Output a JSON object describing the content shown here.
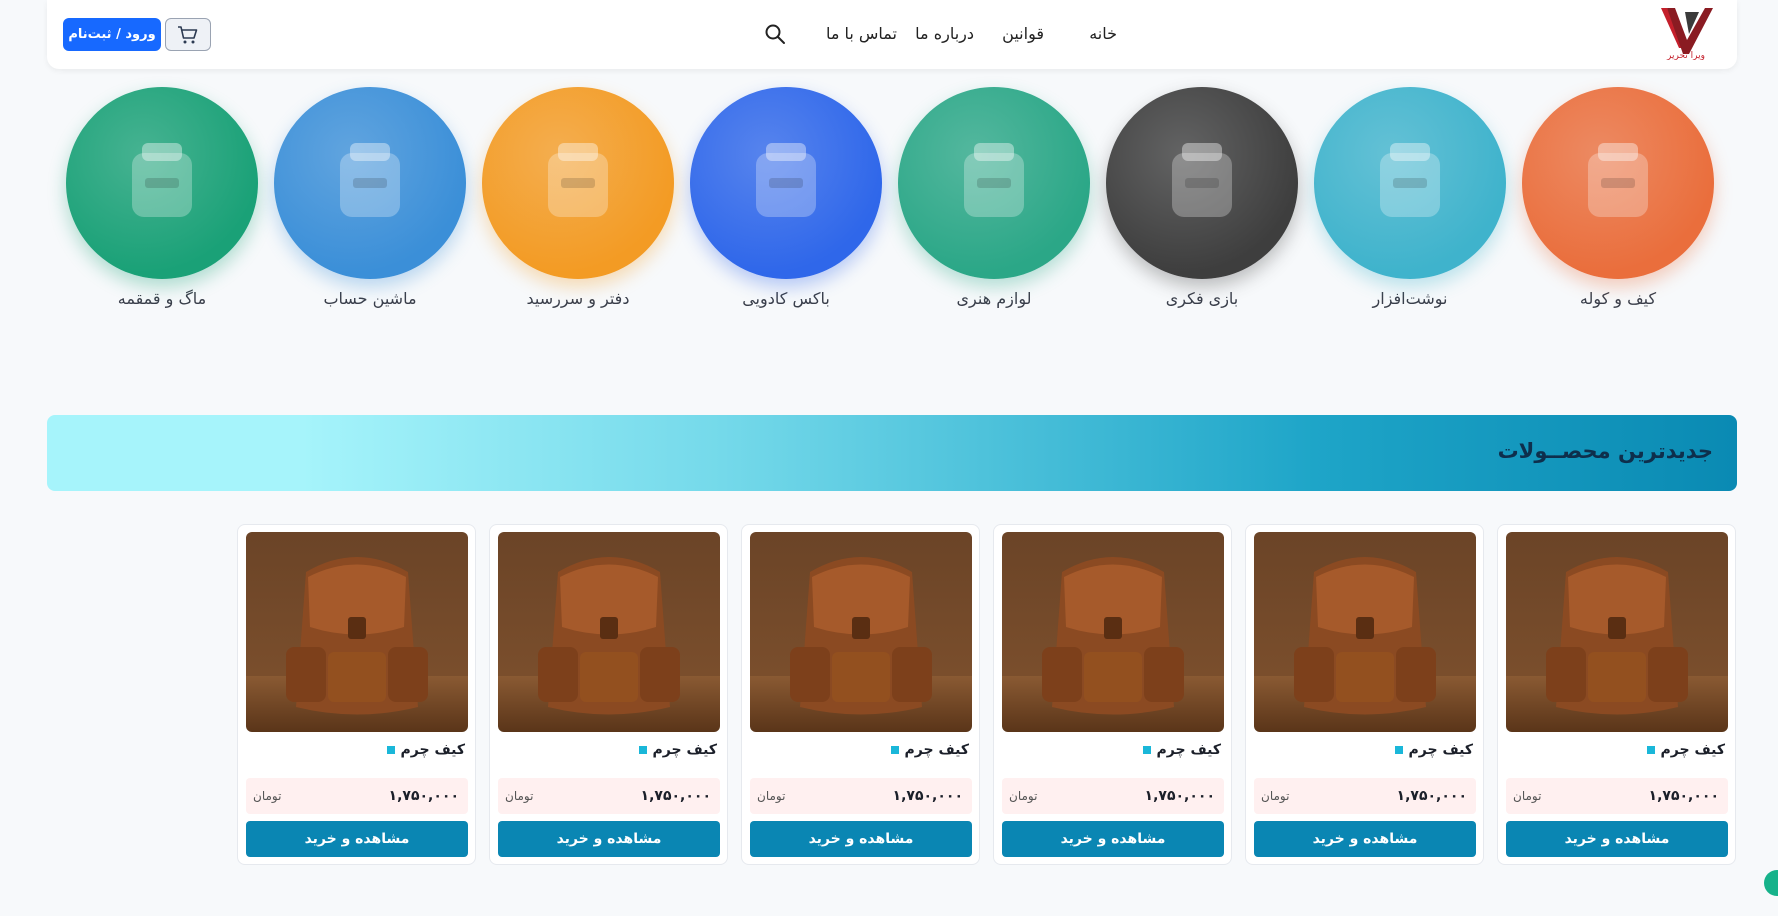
{
  "header": {
    "logo_text": "ویرا تحریر",
    "nav": {
      "home": "خانه",
      "rules": "قوانین",
      "about": "درباره ما",
      "contact": "تماس با ما"
    },
    "login_label": "ورود / ثبت‌نام",
    "icons": [
      "search-icon",
      "cart-icon"
    ]
  },
  "categories": [
    {
      "label": "کیف و کوله",
      "color": "#ea6e3c"
    },
    {
      "label": "نوشت‌افزار",
      "color": "#3fb3cc"
    },
    {
      "label": "بازی فکری",
      "color": "#3e3e3e"
    },
    {
      "label": "لوازم هنری",
      "color": "#2ba787"
    },
    {
      "label": "باکس کادویی",
      "color": "#2f67ea"
    },
    {
      "label": "دفتر و سررسید",
      "color": "#f39b24"
    },
    {
      "label": "ماشین حساب",
      "color": "#3b8fd8"
    },
    {
      "label": "ماگ و قمقمه",
      "color": "#1aa177"
    }
  ],
  "section": {
    "title": "جدیدترین محصــولات"
  },
  "products": [
    {
      "title": "کیف چرم",
      "price": "۱,۷۵۰,۰۰۰",
      "currency": "تومان",
      "button": "مشاهده و خرید"
    },
    {
      "title": "کیف چرم",
      "price": "۱,۷۵۰,۰۰۰",
      "currency": "تومان",
      "button": "مشاهده و خرید"
    },
    {
      "title": "کیف چرم",
      "price": "۱,۷۵۰,۰۰۰",
      "currency": "تومان",
      "button": "مشاهده و خرید"
    },
    {
      "title": "کیف چرم",
      "price": "۱,۷۵۰,۰۰۰",
      "currency": "تومان",
      "button": "مشاهده و خرید"
    },
    {
      "title": "کیف چرم",
      "price": "۱,۷۵۰,۰۰۰",
      "currency": "تومان",
      "button": "مشاهده و خرید"
    },
    {
      "title": "کیف چرم",
      "price": "۱,۷۵۰,۰۰۰",
      "currency": "تومان",
      "button": "مشاهده و خرید"
    }
  ],
  "colors": {
    "primary": "#0a86b3",
    "login": "#1769ff",
    "accent_dot": "#1ab7d9"
  }
}
